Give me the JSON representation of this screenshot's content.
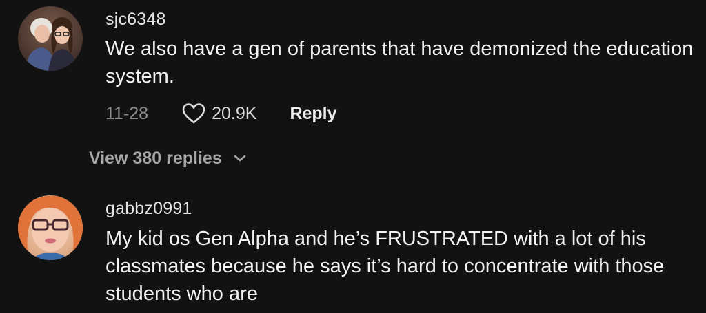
{
  "comments": [
    {
      "username": "sjc6348",
      "text": "We also have a gen of parents that have demonized the education system.",
      "date": "11-28",
      "likes": "20.9K",
      "reply_label": "Reply",
      "view_replies_label": "View 380 replies",
      "avatar_icon": "profile-photo-two-women"
    },
    {
      "username": "gabbz0991",
      "text": "My kid os Gen Alpha and he’s FRUSTRATED with a lot of his classmates because he says it’s hard to concentrate with those students who are",
      "avatar_icon": "profile-photo-woman-glasses"
    }
  ],
  "colors": {
    "background": "#121212",
    "text": "#f2f2f2",
    "muted": "#8f8f8f",
    "view_replies": "#a6a6a6"
  }
}
